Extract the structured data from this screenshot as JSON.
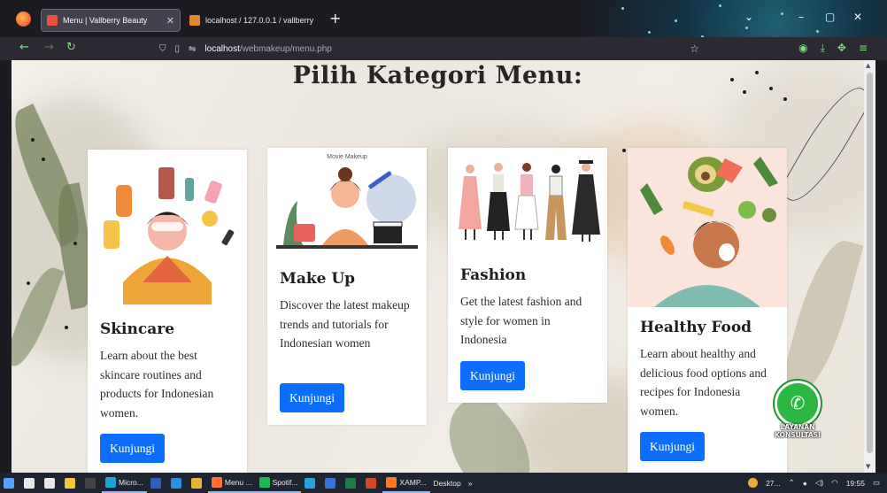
{
  "browser": {
    "tabs": [
      {
        "title": "Menu | Vallberry Beauty",
        "active": true
      },
      {
        "title": "localhost / 127.0.0.1 / vallberry |",
        "active": false
      }
    ],
    "new_tab": "+",
    "url_host": "localhost",
    "url_path": "/webmakeup/menu.php",
    "controls": {
      "minimize": "–",
      "maximize": "▢",
      "close": "✕",
      "chevron": "⌄"
    }
  },
  "page": {
    "title": "Pilih Kategori Menu:",
    "cards": [
      {
        "name": "Skincare",
        "description": "Learn about the best skincare routines and products for Indonesian women.",
        "button": "Kunjungi",
        "media_icon": "skincare-illustration"
      },
      {
        "name": "Make Up",
        "description": "Discover the latest makeup trends and tutorials for Indonesian women",
        "button": "Kunjungi",
        "media_caption": "Movie Makeup",
        "media_icon": "makeup-illustration"
      },
      {
        "name": "Fashion",
        "description": "Get the latest fashion and style for women in Indonesia",
        "button": "Kunjungi",
        "media_icon": "fashion-illustration"
      },
      {
        "name": "Healthy Food",
        "description": "Learn about healthy and delicious food options and recipes for Indonesia women.",
        "button": "Kunjungi",
        "media_icon": "healthy-food-illustration"
      }
    ],
    "whatsapp": {
      "line1": "LAYANAN",
      "line2": "KONSULTASI",
      "icon": "whatsapp-icon"
    }
  },
  "taskbar": {
    "items": [
      {
        "label": "",
        "icon": "windows-start-icon",
        "color": "#5aa0ff"
      },
      {
        "label": "",
        "icon": "search-icon",
        "color": "#e8e8e8"
      },
      {
        "label": "",
        "icon": "cortana-icon",
        "color": "#e8e8e8"
      },
      {
        "label": "",
        "icon": "file-explorer-icon",
        "color": "#f4c542"
      },
      {
        "label": "",
        "icon": "cmd-icon",
        "color": "#444"
      },
      {
        "label": "Micro...",
        "icon": "edge-icon",
        "color": "#1fa3d6"
      },
      {
        "label": "",
        "icon": "word-icon",
        "color": "#2b5fb8"
      },
      {
        "label": "",
        "icon": "vscode-icon",
        "color": "#2c8fde"
      },
      {
        "label": "",
        "icon": "chrome-icon",
        "color": "#e7b43b"
      },
      {
        "label": "Menu ...",
        "icon": "firefox-icon",
        "color": "#ff7139"
      },
      {
        "label": "Spotif...",
        "icon": "spotify-icon",
        "color": "#1db954"
      },
      {
        "label": "",
        "icon": "telegram-icon",
        "color": "#2aa1da"
      },
      {
        "label": "",
        "icon": "app-icon",
        "color": "#3a6fd8"
      },
      {
        "label": "",
        "icon": "excel-icon",
        "color": "#1f7a46"
      },
      {
        "label": "",
        "icon": "powerpoint-icon",
        "color": "#d24726"
      },
      {
        "label": "XAMP...",
        "icon": "xampp-icon",
        "color": "#fb7a24"
      },
      {
        "label": "Desktop",
        "icon": "",
        "color": ""
      }
    ],
    "overflow": "»",
    "weather": "27...",
    "time": "19:55"
  },
  "colors": {
    "accent": "#0d6efd",
    "whatsapp": "#2bb741",
    "browser_bg": "#1c1b22"
  }
}
